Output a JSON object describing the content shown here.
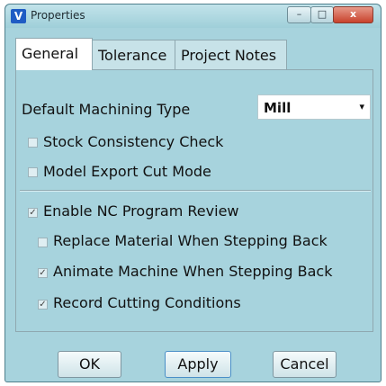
{
  "window": {
    "title": "Properties",
    "app_icon": "V"
  },
  "caption_buttons": {
    "minimize": "–",
    "maximize": "□",
    "close": "x"
  },
  "tabs": [
    {
      "label": "General",
      "active": true
    },
    {
      "label": "Tolerance",
      "active": false
    },
    {
      "label": "Project Notes",
      "active": false
    }
  ],
  "general": {
    "machining_type_label": "Default Machining Type",
    "machining_type_value": "Mill",
    "dropdown_arrow": "▾",
    "checkboxes": [
      {
        "label": "Stock Consistency Check",
        "checked": false,
        "mark": ""
      },
      {
        "label": "Model Export Cut Mode",
        "checked": false,
        "mark": ""
      },
      {
        "label": "Enable NC Program Review",
        "checked": true,
        "mark": "✓"
      },
      {
        "label": "Replace Material When Stepping Back",
        "checked": false,
        "mark": ""
      },
      {
        "label": "Animate Machine When Stepping Back",
        "checked": true,
        "mark": "✓"
      },
      {
        "label": "Record Cutting Conditions",
        "checked": true,
        "mark": "✓"
      }
    ]
  },
  "buttons": {
    "ok": "OK",
    "apply": "Apply",
    "cancel": "Cancel"
  },
  "colors": {
    "background": "#a7d3dd",
    "active_tab": "#ffffff"
  }
}
